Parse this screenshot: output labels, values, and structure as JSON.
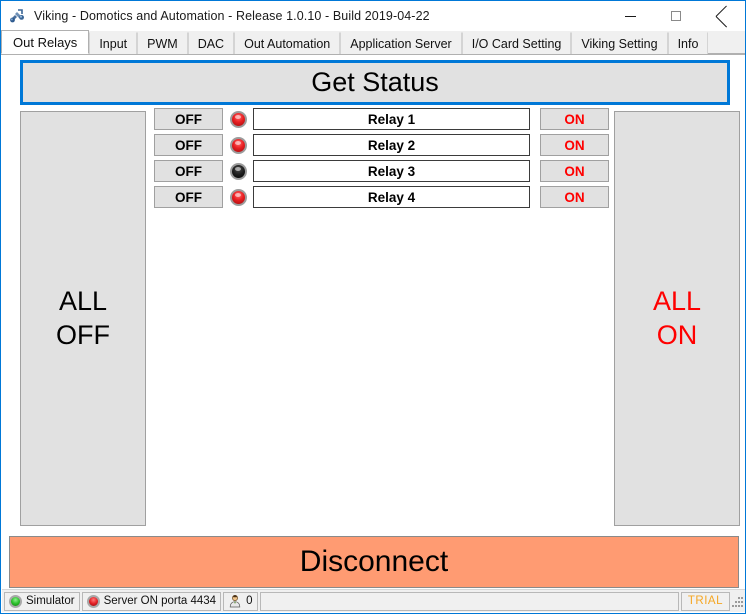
{
  "window": {
    "title": "Viking - Domotics and Automation - Release 1.0.10 - Build 2019-04-22",
    "icon": "viking-app-icon",
    "controls": {
      "minimize": "minimize-icon",
      "maximize": "maximize-icon",
      "close": "close-icon"
    },
    "border_color": "#0078d7"
  },
  "tabs": [
    {
      "label": "Out Relays",
      "active": true
    },
    {
      "label": "Input",
      "active": false
    },
    {
      "label": "PWM",
      "active": false
    },
    {
      "label": "DAC",
      "active": false
    },
    {
      "label": "Out Automation",
      "active": false
    },
    {
      "label": "Application Server",
      "active": false
    },
    {
      "label": "I/O Card Setting",
      "active": false
    },
    {
      "label": "Viking Setting",
      "active": false
    },
    {
      "label": "Info",
      "active": false
    }
  ],
  "main": {
    "get_status_label": "Get Status",
    "get_status_focus_color": "#0078d7",
    "all_off_label": "ALL\nOFF",
    "all_off_line1": "ALL",
    "all_off_line2": "OFF",
    "all_on_label": "ALL\nON",
    "all_on_line1": "ALL",
    "all_on_line2": "ON",
    "all_on_color": "#ff0000",
    "disconnect_label": "Disconnect",
    "disconnect_color": "#ff9b72"
  },
  "relays": [
    {
      "off_label": "OFF",
      "led": "led-on",
      "led_state": "on",
      "name": "Relay 1",
      "on_label": "ON"
    },
    {
      "off_label": "OFF",
      "led": "led-on",
      "led_state": "on",
      "name": "Relay 2",
      "on_label": "ON"
    },
    {
      "off_label": "OFF",
      "led": "led-off",
      "led_state": "off",
      "name": "Relay 3",
      "on_label": "ON"
    },
    {
      "off_label": "OFF",
      "led": "led-on",
      "led_state": "on",
      "name": "Relay 4",
      "on_label": "ON"
    }
  ],
  "status_bar": {
    "simulator": {
      "led": "green",
      "label": "Simulator"
    },
    "server": {
      "led": "red",
      "label": "Server ON porta 4434"
    },
    "clients": {
      "icon": "user-icon",
      "count": "0"
    },
    "message": "",
    "trial_label": "TRIAL",
    "trial_color": "#f5a623",
    "grip": "resize-grip-icon"
  }
}
